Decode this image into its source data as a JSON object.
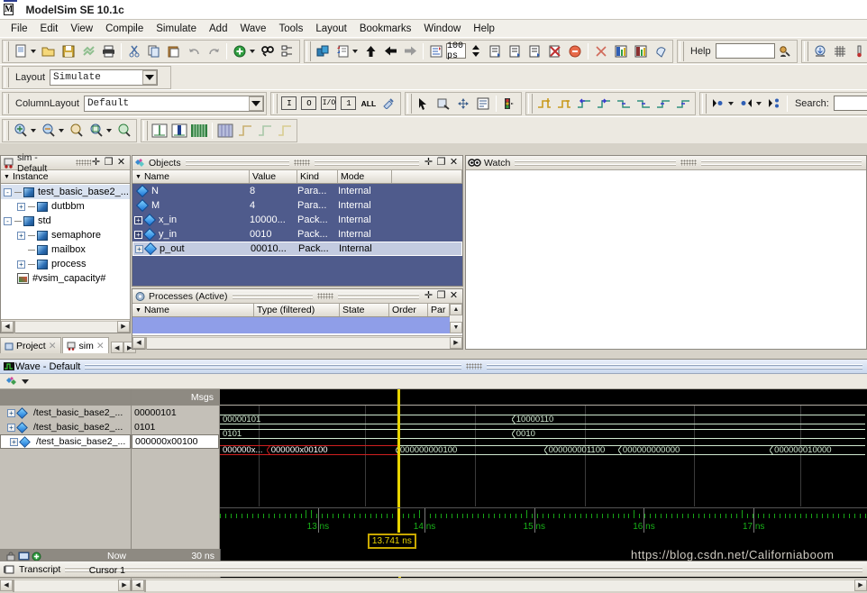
{
  "window": {
    "title": "ModelSim SE 10.1c",
    "logo_letter": "M"
  },
  "menubar": {
    "items": [
      "File",
      "Edit",
      "View",
      "Compile",
      "Simulate",
      "Add",
      "Wave",
      "Tools",
      "Layout",
      "Bookmarks",
      "Window",
      "Help"
    ]
  },
  "toolbar": {
    "timestep_value": "100 ps",
    "help_label": "Help",
    "help_value": "",
    "search_label": "Search:",
    "search_value": ""
  },
  "layout_bar": {
    "layout_label": "Layout",
    "layout_value": "Simulate",
    "columnlayout_label": "ColumnLayout",
    "columnlayout_value": "Default",
    "radix_buttons": [
      "I",
      "O",
      "I/O",
      "1",
      "ALL"
    ]
  },
  "sim_panel": {
    "title": "sim - Default",
    "column_header": "Instance",
    "tree": [
      {
        "label": "test_basic_base2_...",
        "depth": 0,
        "expander": "-",
        "icon": "module-icon",
        "selected": true
      },
      {
        "label": "dutbbm",
        "depth": 1,
        "expander": "+",
        "icon": "module-icon",
        "selected": false
      },
      {
        "label": "std",
        "depth": 0,
        "expander": "-",
        "icon": "module-icon",
        "selected": false
      },
      {
        "label": "semaphore",
        "depth": 1,
        "expander": "+",
        "icon": "module-icon",
        "selected": false
      },
      {
        "label": "mailbox",
        "depth": 1,
        "expander": "",
        "icon": "module-icon",
        "selected": false
      },
      {
        "label": "process",
        "depth": 1,
        "expander": "+",
        "icon": "module-icon",
        "selected": false
      },
      {
        "label": "#vsim_capacity#",
        "depth": 1,
        "expander": "",
        "icon": "capacity-icon",
        "selected": false
      }
    ],
    "tabs": [
      {
        "label": "Project",
        "active": false
      },
      {
        "label": "sim",
        "active": true
      }
    ]
  },
  "objects_panel": {
    "title": "Objects",
    "columns": [
      "Name",
      "Value",
      "Kind",
      "Mode"
    ],
    "rows": [
      {
        "name": "N",
        "value": "8",
        "kind": "Para...",
        "mode": "Internal",
        "expandable": false,
        "selected": false
      },
      {
        "name": "M",
        "value": "4",
        "kind": "Para...",
        "mode": "Internal",
        "expandable": false,
        "selected": false
      },
      {
        "name": "x_in",
        "value": "10000...",
        "kind": "Pack...",
        "mode": "Internal",
        "expandable": true,
        "selected": false
      },
      {
        "name": "y_in",
        "value": "0010",
        "kind": "Pack...",
        "mode": "Internal",
        "expandable": true,
        "selected": false
      },
      {
        "name": "p_out",
        "value": "00010...",
        "kind": "Pack...",
        "mode": "Internal",
        "expandable": true,
        "selected": true
      }
    ]
  },
  "processes_panel": {
    "title": "Processes (Active)",
    "columns": [
      "Name",
      "Type (filtered)",
      "State",
      "Order",
      "Par"
    ],
    "rows": []
  },
  "watch_panel": {
    "title": "Watch"
  },
  "wave_panel": {
    "title": "Wave - Default",
    "msgs_header": "Msgs",
    "signals": [
      {
        "name": "/test_basic_base2_...",
        "value": "00000101",
        "expandable": true,
        "selected": false
      },
      {
        "name": "/test_basic_base2_...",
        "value": "0101",
        "expandable": true,
        "selected": false
      },
      {
        "name": "/test_basic_base2_...",
        "value": "000000x00100",
        "expandable": true,
        "selected": true
      }
    ],
    "waves": [
      {
        "signal_index": 0,
        "segments": [
          {
            "text": "00000101",
            "start_pct": 0.0,
            "end_pct": 45.5,
            "state": "valid"
          },
          {
            "text": "10000110",
            "start_pct": 45.5,
            "end_pct": 100.0,
            "state": "valid"
          }
        ]
      },
      {
        "signal_index": 1,
        "segments": [
          {
            "text": "0101",
            "start_pct": 0.0,
            "end_pct": 45.5,
            "state": "valid"
          },
          {
            "text": "0010",
            "start_pct": 45.5,
            "end_pct": 100.0,
            "state": "valid"
          }
        ]
      },
      {
        "signal_index": 2,
        "segments": [
          {
            "text": "000000x...",
            "start_pct": 0.0,
            "end_pct": 7.5,
            "state": "unknown"
          },
          {
            "text": "000000x00100",
            "start_pct": 7.5,
            "end_pct": 27.5,
            "state": "unknown"
          },
          {
            "text": "000000000100",
            "start_pct": 27.5,
            "end_pct": 50.5,
            "state": "valid"
          },
          {
            "text": "000000001100",
            "start_pct": 50.5,
            "end_pct": 62.0,
            "state": "valid"
          },
          {
            "text": "000000000000",
            "start_pct": 62.0,
            "end_pct": 85.5,
            "state": "valid"
          },
          {
            "text": "000000010000",
            "start_pct": 85.5,
            "end_pct": 100.0,
            "state": "valid"
          }
        ]
      }
    ],
    "ruler": {
      "labels": [
        "13 ns",
        "14 ns",
        "15 ns",
        "16 ns",
        "17 ns"
      ],
      "label_pcts": [
        13.5,
        30.0,
        47.0,
        64.0,
        81.0
      ]
    },
    "cursor": {
      "label": "13.741 ns",
      "pct": 27.5
    },
    "status": {
      "now_label": "Now",
      "now_value": "30 ns",
      "cursor_label": "Cursor 1",
      "cursor_value": "13.741 ns"
    }
  },
  "transcript": {
    "title": "Transcript"
  },
  "watermark": {
    "text": "https://blog.csdn.net/Californiaboom"
  },
  "colors": {
    "wave_bg": "#000000",
    "wave_valid": "#cfe8cf",
    "wave_unknown": "#d02020",
    "cursor": "#e8d400",
    "ruler_text": "#19b219",
    "selection": "#4f5b8c"
  }
}
